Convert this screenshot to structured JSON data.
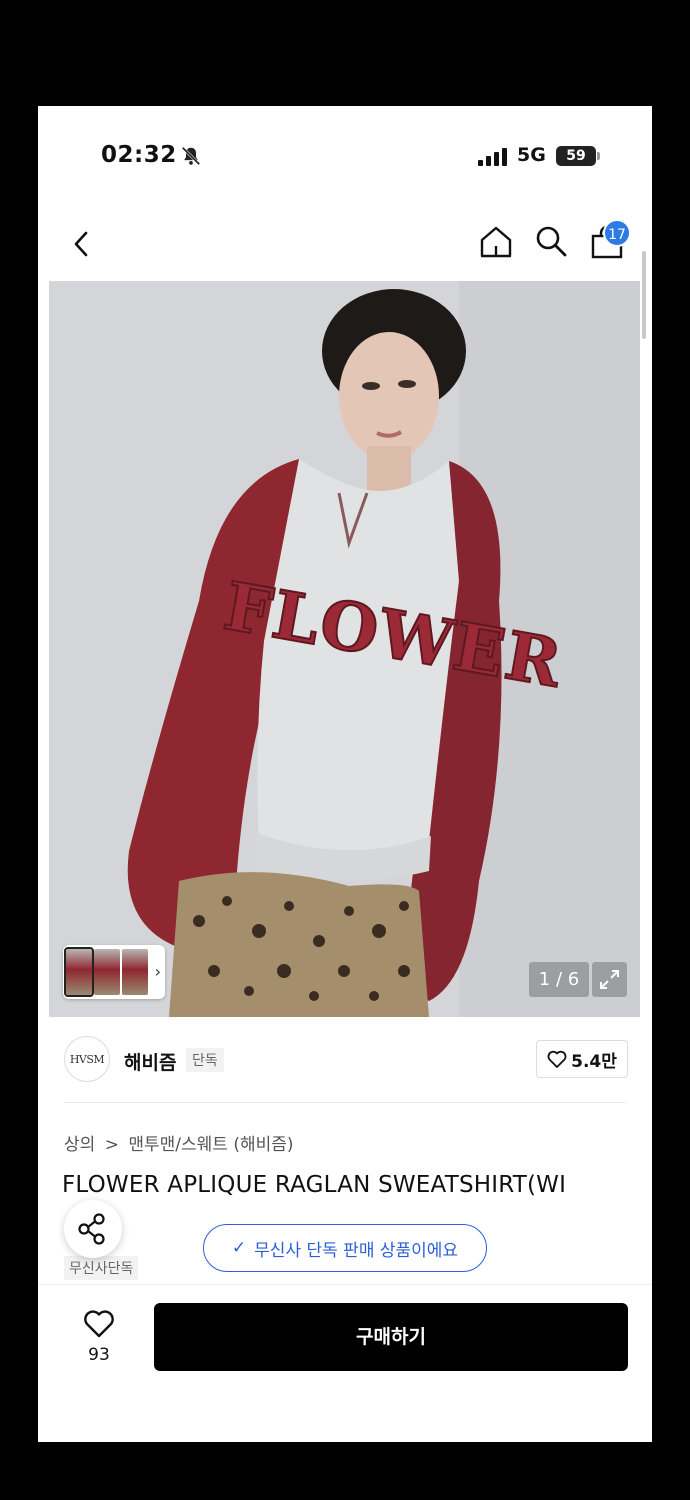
{
  "status_bar": {
    "time": "02:32",
    "network": "5G",
    "battery": "59"
  },
  "nav": {
    "cart_count": "17",
    "icons": [
      "chevron-left-icon",
      "home-icon",
      "search-icon",
      "shopping-bag-icon"
    ]
  },
  "gallery": {
    "pager": "1 / 6",
    "thumb_count": 3,
    "print_text": "FLOWER"
  },
  "brand": {
    "logo_text": "HVSM",
    "name": "해비즘",
    "tag": "단독",
    "likes": "5.4만"
  },
  "product": {
    "breadcrumb_category": "상의",
    "breadcrumb_separator": ">",
    "breadcrumb_sub": "맨투맨/스웨트 (해비즘)",
    "title": "FLOWER APLIQUE RAGLAN SWEATSHIRT(WI",
    "exclusive_label": "무신사단독"
  },
  "toast": {
    "message": "무신사 단독 판매 상품이에요"
  },
  "bottom": {
    "wish_count": "93",
    "buy_label": "구매하기"
  },
  "colors": {
    "accent_blue": "#2c5fd8",
    "badge_blue": "#2c7be5",
    "buy_button": "#000000",
    "sleeve_burgundy": "#8e2730"
  }
}
